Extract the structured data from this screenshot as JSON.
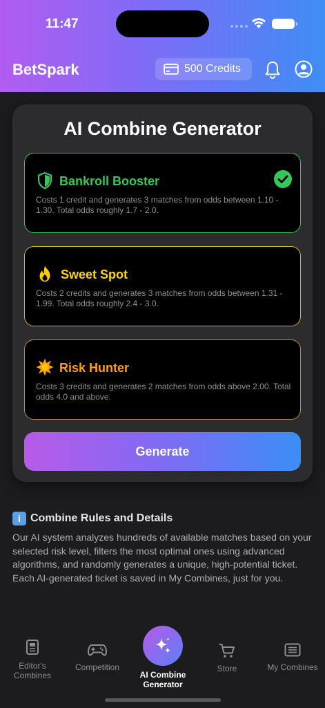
{
  "status": {
    "time": "11:47"
  },
  "header": {
    "brand": "BetSpark",
    "credits": "500 Credits",
    "icons": [
      "wallet-icon",
      "bell-icon",
      "profile-icon"
    ]
  },
  "card": {
    "title": "AI Combine Generator",
    "options": [
      {
        "title": "Bankroll Booster",
        "desc": "Costs 1 credit and generates 3 matches from odds between 1.10 - 1.30. Total odds roughly 1.7 - 2.0.",
        "selected": true,
        "icon": "shield-icon",
        "color": "#34c759"
      },
      {
        "title": "Sweet Spot",
        "desc": "Costs 2 credits and generates 3 matches from odds between 1.31 - 1.99. Total odds roughly 2.4 - 3.0.",
        "selected": false,
        "icon": "flame-icon",
        "color": "#ffd60a"
      },
      {
        "title": "Risk Hunter",
        "desc": "Costs 3 credits and generates 2 matches from odds above 2.00. Total odds 4.0 and above.",
        "selected": false,
        "icon": "explosion-icon",
        "color": "#ff9f0a"
      }
    ],
    "generate_label": "Generate"
  },
  "rules": {
    "title": "Combine Rules and Details",
    "text": "Our AI system analyzes hundreds of available matches based on your selected risk level, filters the most optimal ones using advanced algorithms, and randomly generates a unique, high-potential ticket. Each AI-generated ticket is saved in My Combines, just for you."
  },
  "tabbar": {
    "items": [
      {
        "label": "Editor's Combines",
        "icon": "document-icon"
      },
      {
        "label": "Competition",
        "icon": "gamepad-icon"
      },
      {
        "label": "AI Combine Generator",
        "icon": "sparkles-icon",
        "active": true
      },
      {
        "label": "Store",
        "icon": "cart-icon"
      },
      {
        "label": "My Combines",
        "icon": "list-icon"
      }
    ]
  }
}
